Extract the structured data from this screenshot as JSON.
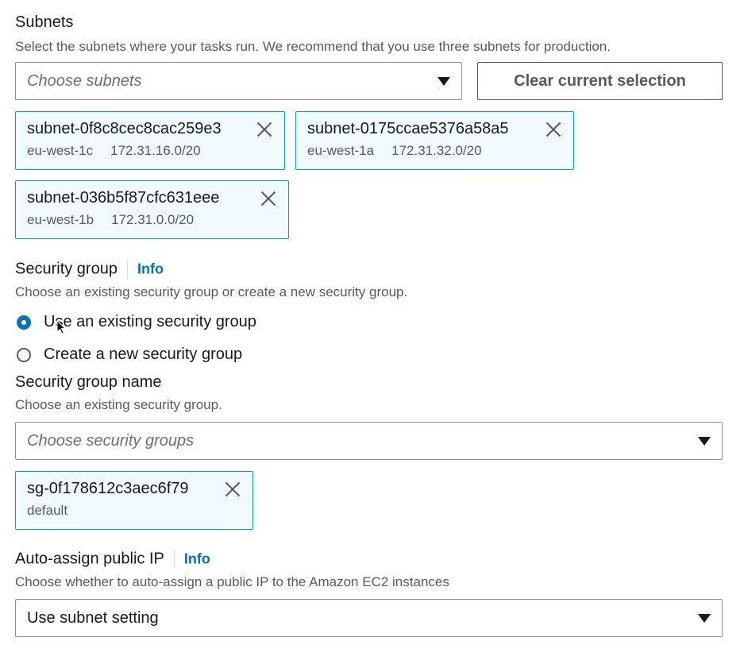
{
  "subnets": {
    "label": "Subnets",
    "description": "Select the subnets where your tasks run. We recommend that you use three subnets for production.",
    "placeholder": "Choose subnets",
    "clear_label": "Clear current selection",
    "tokens": [
      {
        "id": "subnet-0f8c8cec8cac259e3",
        "zone": "eu-west-1c",
        "cidr": "172.31.16.0/20"
      },
      {
        "id": "subnet-0175ccae5376a58a5",
        "zone": "eu-west-1a",
        "cidr": "172.31.32.0/20"
      },
      {
        "id": "subnet-036b5f87cfc631eee",
        "zone": "eu-west-1b",
        "cidr": "172.31.0.0/20"
      }
    ]
  },
  "security_group": {
    "label": "Security group",
    "info": "Info",
    "description": "Choose an existing security group or create a new security group.",
    "options": [
      {
        "label": "Use an existing security group",
        "checked": true
      },
      {
        "label": "Create a new security group",
        "checked": false
      }
    ],
    "name_label": "Security group name",
    "name_description": "Choose an existing security group.",
    "placeholder": "Choose security groups",
    "tokens": [
      {
        "id": "sg-0f178612c3aec6f79",
        "sub": "default"
      }
    ]
  },
  "public_ip": {
    "label": "Auto-assign public IP",
    "info": "Info",
    "description": "Choose whether to auto-assign a public IP to the Amazon EC2 instances",
    "value": "Use subnet setting"
  },
  "colors": {
    "accent": "#0073bb",
    "token_bg": "#f1faff",
    "token_border": "#00a1c9"
  }
}
